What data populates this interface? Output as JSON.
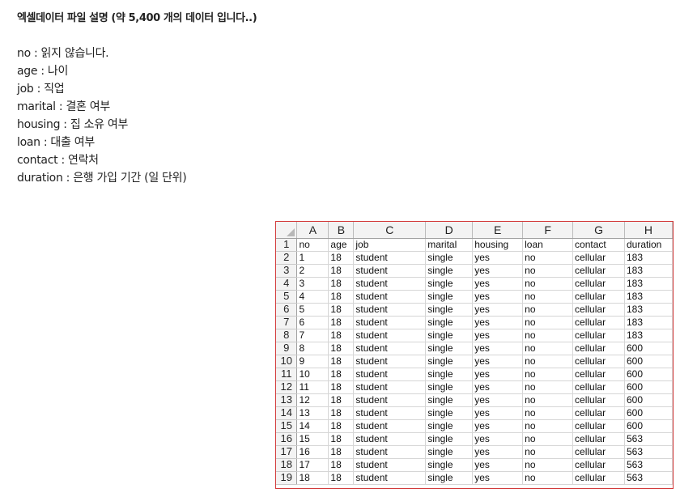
{
  "title": "엑셀데이터 파일 설명 (약 5,400 개의 데이터 입니다..)",
  "descriptions": [
    "no : 읽지 않습니다.",
    "age : 나이",
    "job : 직업",
    "marital : 결혼 여부",
    "housing : 집 소유 여부",
    "loan : 대출 여부",
    "contact : 연락처",
    "duration : 은행 가입 기간 (일 단위)"
  ],
  "spreadsheet": {
    "column_letters": [
      "A",
      "B",
      "C",
      "D",
      "E",
      "F",
      "G",
      "H"
    ],
    "row_numbers": [
      "1",
      "2",
      "3",
      "4",
      "5",
      "6",
      "7",
      "8",
      "9",
      "10",
      "11",
      "12",
      "13",
      "14",
      "15",
      "16",
      "17",
      "18",
      "19"
    ],
    "rows": [
      [
        "no",
        "age",
        "job",
        "marital",
        "housing",
        "loan",
        "contact",
        "duration"
      ],
      [
        "1",
        "18",
        "student",
        "single",
        "yes",
        "no",
        "cellular",
        "183"
      ],
      [
        "2",
        "18",
        "student",
        "single",
        "yes",
        "no",
        "cellular",
        "183"
      ],
      [
        "3",
        "18",
        "student",
        "single",
        "yes",
        "no",
        "cellular",
        "183"
      ],
      [
        "4",
        "18",
        "student",
        "single",
        "yes",
        "no",
        "cellular",
        "183"
      ],
      [
        "5",
        "18",
        "student",
        "single",
        "yes",
        "no",
        "cellular",
        "183"
      ],
      [
        "6",
        "18",
        "student",
        "single",
        "yes",
        "no",
        "cellular",
        "183"
      ],
      [
        "7",
        "18",
        "student",
        "single",
        "yes",
        "no",
        "cellular",
        "183"
      ],
      [
        "8",
        "18",
        "student",
        "single",
        "yes",
        "no",
        "cellular",
        "600"
      ],
      [
        "9",
        "18",
        "student",
        "single",
        "yes",
        "no",
        "cellular",
        "600"
      ],
      [
        "10",
        "18",
        "student",
        "single",
        "yes",
        "no",
        "cellular",
        "600"
      ],
      [
        "11",
        "18",
        "student",
        "single",
        "yes",
        "no",
        "cellular",
        "600"
      ],
      [
        "12",
        "18",
        "student",
        "single",
        "yes",
        "no",
        "cellular",
        "600"
      ],
      [
        "13",
        "18",
        "student",
        "single",
        "yes",
        "no",
        "cellular",
        "600"
      ],
      [
        "14",
        "18",
        "student",
        "single",
        "yes",
        "no",
        "cellular",
        "600"
      ],
      [
        "15",
        "18",
        "student",
        "single",
        "yes",
        "no",
        "cellular",
        "563"
      ],
      [
        "16",
        "18",
        "student",
        "single",
        "yes",
        "no",
        "cellular",
        "563"
      ],
      [
        "17",
        "18",
        "student",
        "single",
        "yes",
        "no",
        "cellular",
        "563"
      ],
      [
        "18",
        "18",
        "student",
        "single",
        "yes",
        "no",
        "cellular",
        "563"
      ]
    ],
    "border_color": "#d23a3a"
  }
}
